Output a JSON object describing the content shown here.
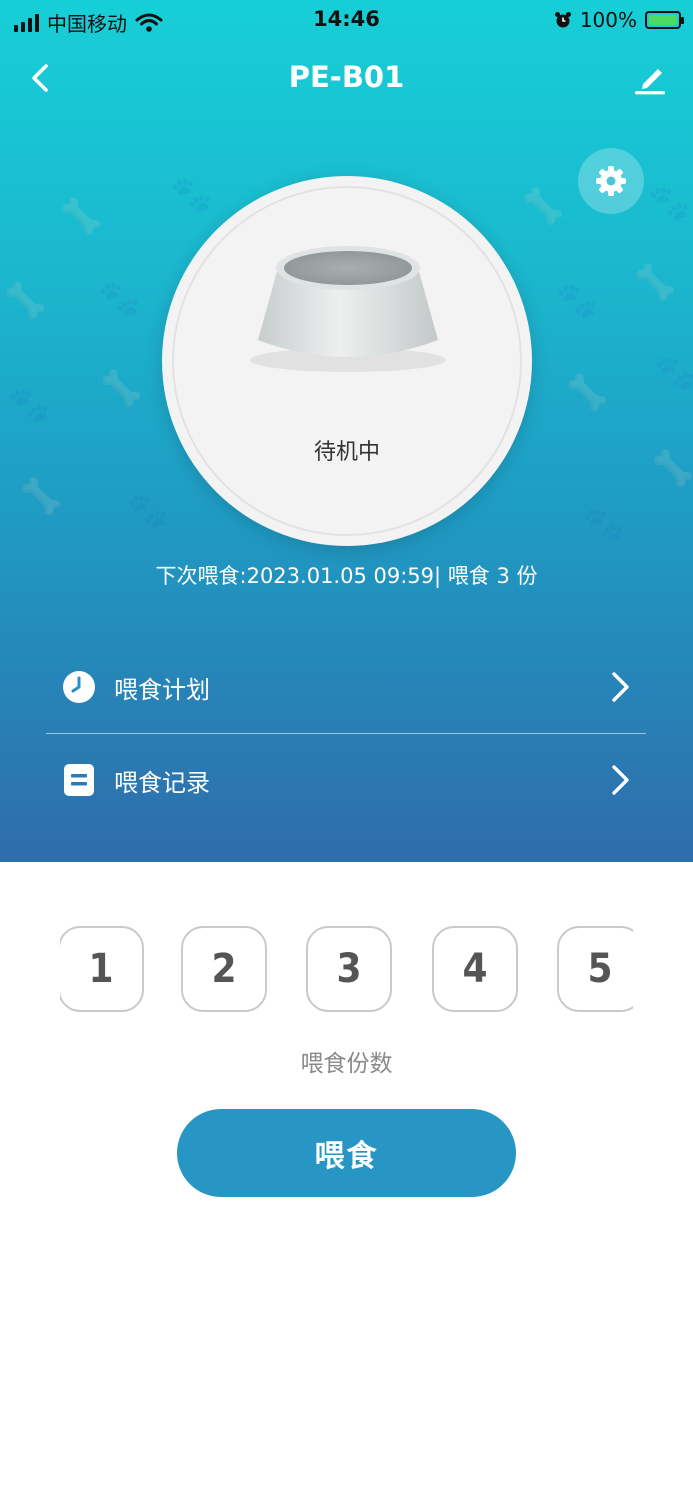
{
  "status_bar": {
    "carrier": "中国移动",
    "time": "14:46",
    "battery": "100%"
  },
  "nav": {
    "title": "PE-B01",
    "back_icon": "chevron-left-icon",
    "edit_icon": "pencil-icon"
  },
  "device": {
    "settings_icon": "gear-icon",
    "state": "待机中",
    "next_feed": "下次喂食:2023.01.05 09:59| 喂食 3 份"
  },
  "menu": {
    "items": [
      {
        "label": "喂食计划",
        "icon": "clock-icon"
      },
      {
        "label": "喂食记录",
        "icon": "document-icon"
      }
    ]
  },
  "portions": {
    "options": [
      "1",
      "2",
      "3",
      "4",
      "5"
    ],
    "label": "喂食份数"
  },
  "feed_button": {
    "label": "喂食"
  },
  "colors": {
    "gradient_top": "#17cfd6",
    "gradient_bottom": "#2f6cab",
    "button": "#2796c4"
  }
}
